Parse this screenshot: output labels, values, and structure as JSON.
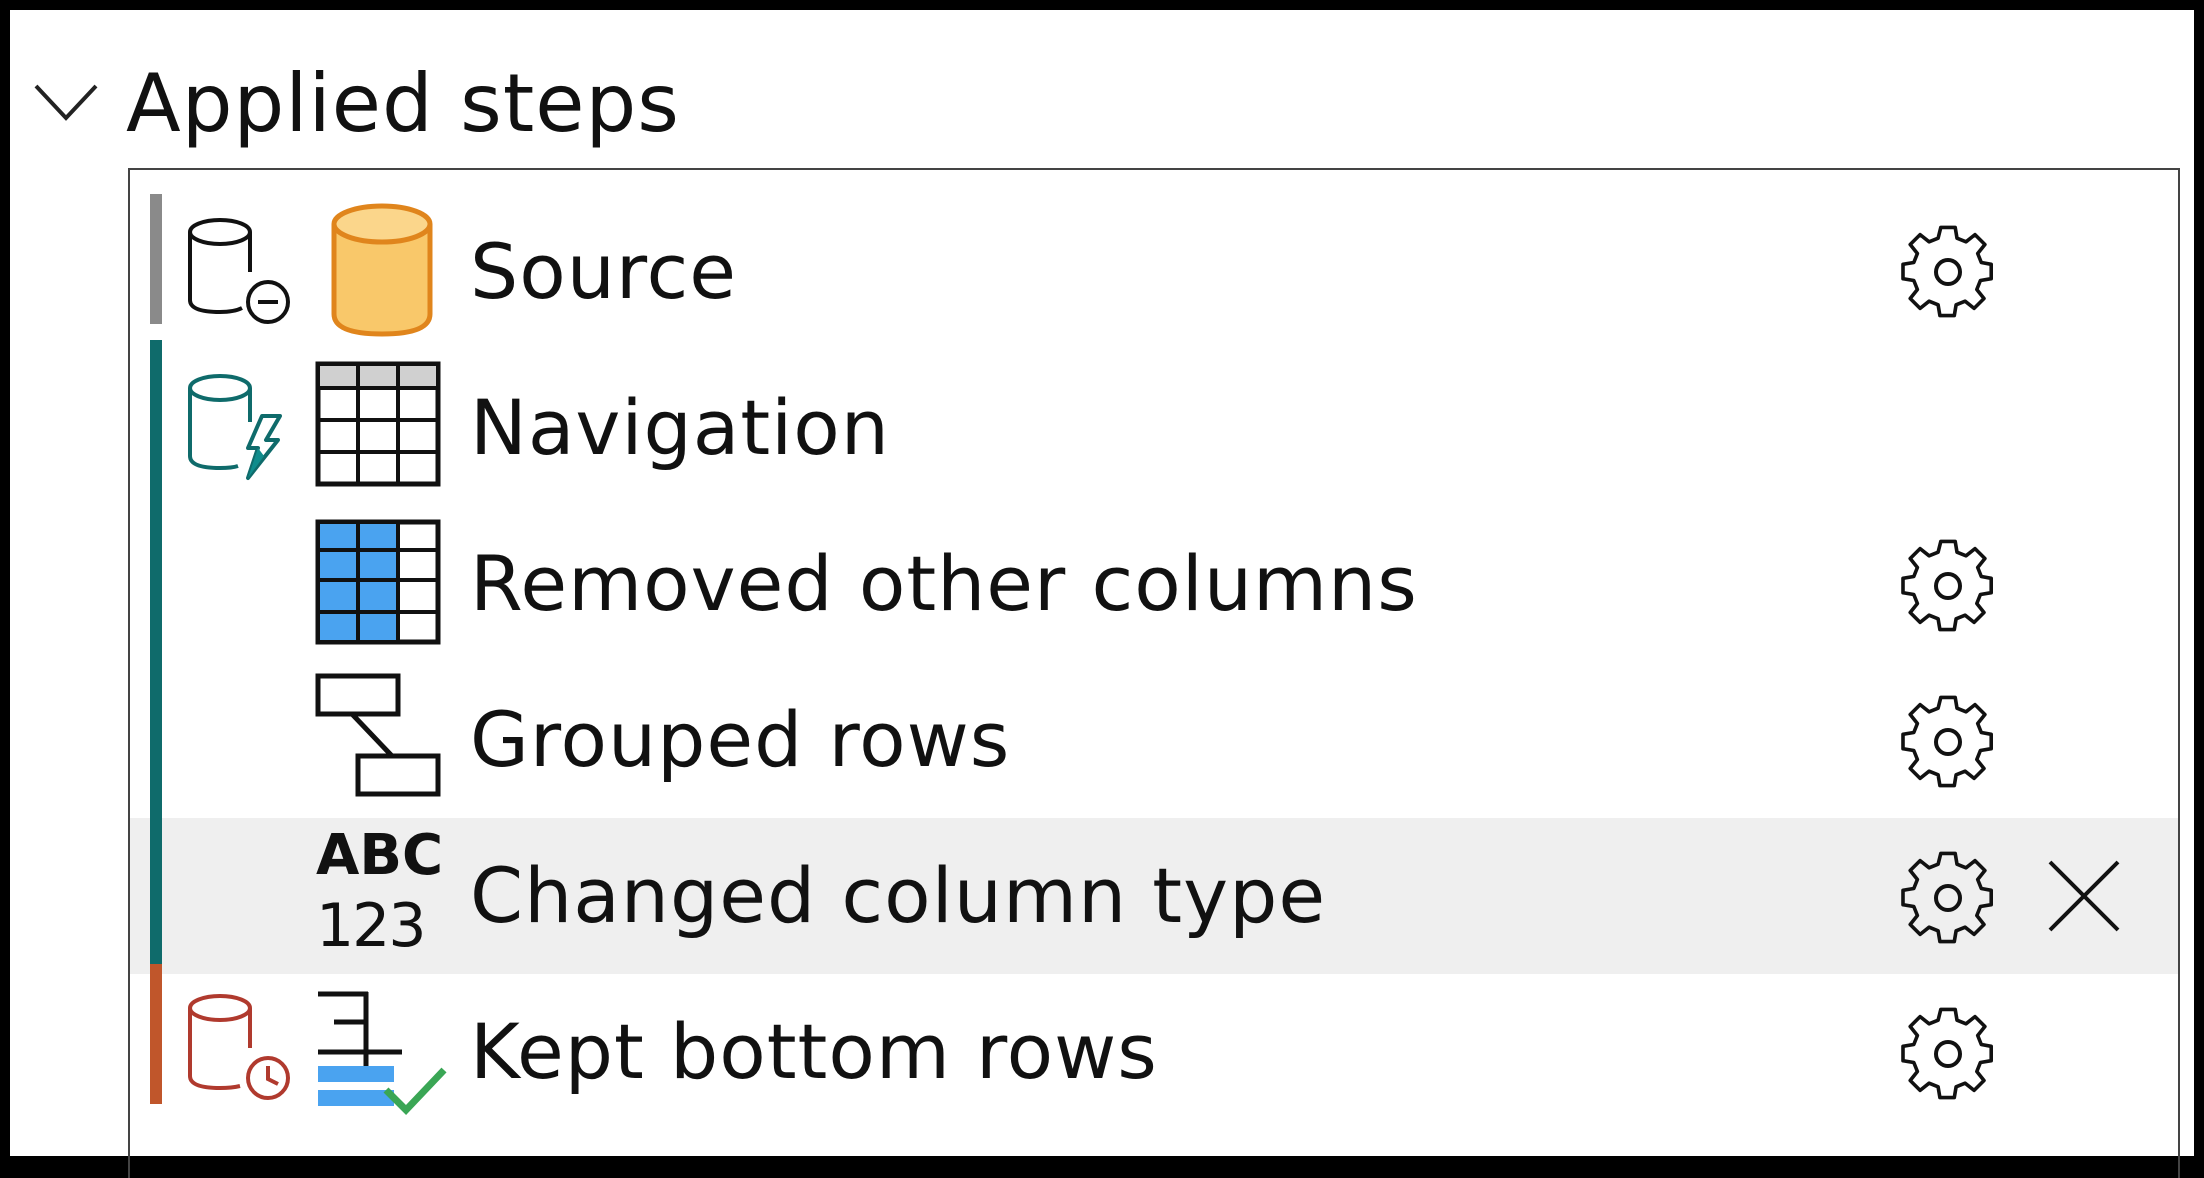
{
  "panel": {
    "title": "Applied steps",
    "collapse_icon": "chevron-down-icon"
  },
  "steps": [
    {
      "label": "Source",
      "icon": "database-cylinder-icon",
      "status": "not-folded",
      "settings": true
    },
    {
      "label": "Navigation",
      "icon": "table-icon",
      "status": "folded",
      "settings": false
    },
    {
      "label": "Removed other columns",
      "icon": "table-columns-icon",
      "status": "folded",
      "settings": true
    },
    {
      "label": "Grouped rows",
      "icon": "group-rows-icon",
      "status": "folded",
      "settings": true
    },
    {
      "label": "Changed column type",
      "icon": "abc-123-icon",
      "icon_text": {
        "top": "ABC",
        "bottom": "123"
      },
      "status": "folded",
      "settings": true,
      "selected": true,
      "delete": true
    },
    {
      "label": "Kept bottom rows",
      "icon": "keep-rows-icon",
      "status": "unknown",
      "settings": true
    }
  ],
  "colors": {
    "folded": "#0f6b6b",
    "not_folded": "#8a8a8a",
    "unknown": "#c0562b",
    "selected_background": "#efefef",
    "source_icon_fill": "#f9c86a",
    "source_icon_stroke": "#e0851c",
    "table_selected_fill": "#4aa3f0"
  }
}
